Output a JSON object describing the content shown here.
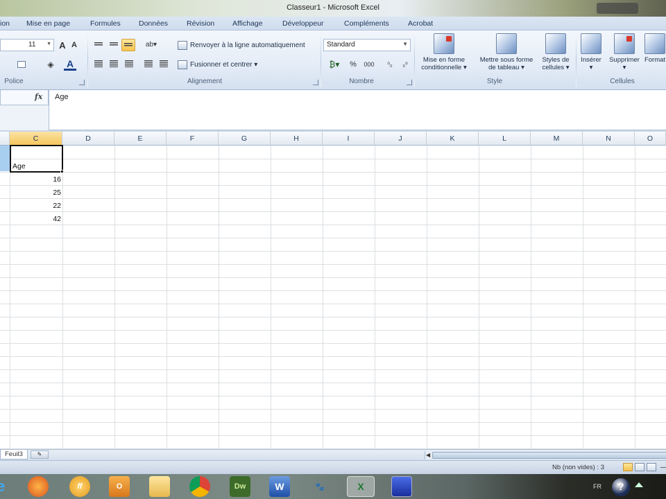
{
  "window": {
    "title": "Classeur1 - Microsoft Excel"
  },
  "tabs": [
    "ion",
    "Mise en page",
    "Formules",
    "Données",
    "Révision",
    "Affichage",
    "Développeur",
    "Compléments",
    "Acrobat"
  ],
  "ribbon": {
    "font_size": "11",
    "wrap_text_label": "Renvoyer à la ligne automatiquement",
    "merge_label": "Fusionner et centrer ▾",
    "number_format": "Standard",
    "style_buttons": [
      {
        "label1": "Mise en forme",
        "label2": "conditionnelle ▾"
      },
      {
        "label1": "Mettre sous forme",
        "label2": "de tableau ▾"
      },
      {
        "label1": "Styles de",
        "label2": "cellules ▾"
      }
    ],
    "cell_buttons": [
      {
        "label1": "Insérer",
        "label2": "▾"
      },
      {
        "label1": "Supprimer",
        "label2": "▾"
      },
      {
        "label1": "Format",
        "label2": ""
      }
    ],
    "groups": {
      "police": "Police",
      "alignement": "Alignement",
      "nombre": "Nombre",
      "style": "Style",
      "cellules": "Cellules"
    }
  },
  "formula_bar": {
    "fx": "fx",
    "value": "Age"
  },
  "columns": [
    "C",
    "D",
    "E",
    "F",
    "G",
    "H",
    "I",
    "J",
    "K",
    "L",
    "M",
    "N",
    "O"
  ],
  "active_column": "C",
  "cells": {
    "header": "Age",
    "values": [
      "16",
      "25",
      "22",
      "42"
    ]
  },
  "sheet_tab": "Feuil3",
  "status": {
    "count_text": "Nb (non vides) : 3"
  },
  "taskbar": {
    "lang": "FR",
    "help": "?"
  }
}
